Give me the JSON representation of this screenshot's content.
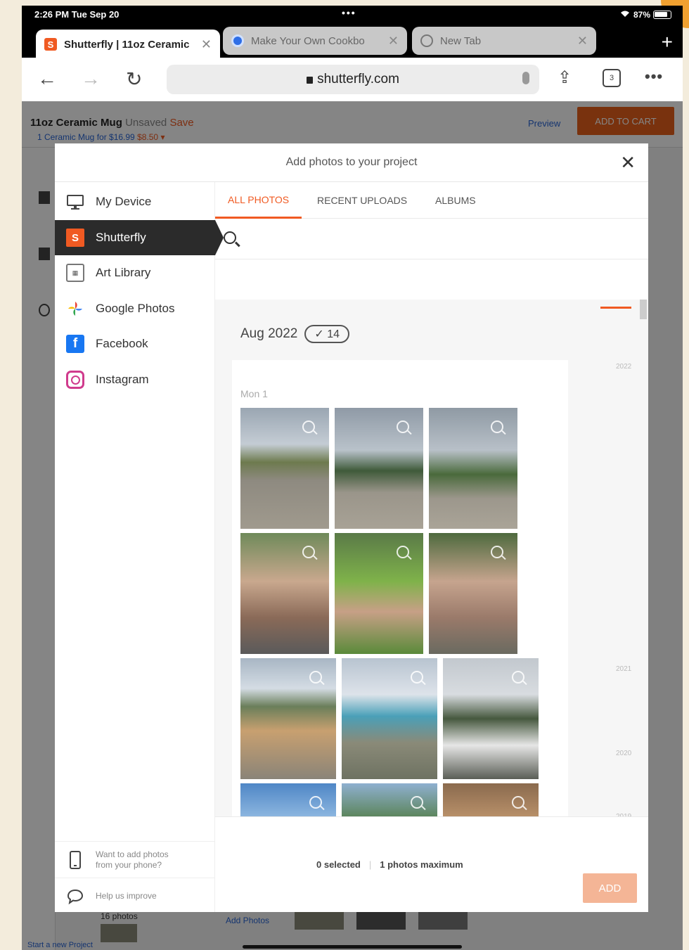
{
  "status_bar": {
    "time": "2:26 PM  Tue Sep 20",
    "dots": "•••",
    "battery": "87%"
  },
  "browser": {
    "tabs": [
      {
        "title": "Shutterfly | 11oz Ceramic"
      },
      {
        "title": "Make Your Own Cookbo"
      },
      {
        "title": "New Tab"
      }
    ],
    "url": "shutterfly.com",
    "tab_count": "3",
    "new_tab": "+"
  },
  "background_page": {
    "product": "11oz Ceramic Mug",
    "unsaved": "Unsaved",
    "save": "Save",
    "subtitle": "1 Ceramic Mug for $16.99",
    "subtitle_price": "$8.50 ▾",
    "preview": "Preview",
    "add_to_cart": "ADD TO CART",
    "photos_label": "16 photos",
    "add_photos": "Add Photos",
    "footer_link": "Start a new Project"
  },
  "modal": {
    "title": "Add photos to your project",
    "close": "✕",
    "sources": [
      {
        "label": "My Device",
        "icon": "monitor-icon"
      },
      {
        "label": "Shutterfly",
        "icon": "shutterfly-icon"
      },
      {
        "label": "Art Library",
        "icon": "art-library-icon"
      },
      {
        "label": "Google Photos",
        "icon": "google-photos-icon"
      },
      {
        "label": "Facebook",
        "icon": "facebook-icon"
      },
      {
        "label": "Instagram",
        "icon": "instagram-icon"
      }
    ],
    "phone_prompt": [
      "Want to add photos",
      "from your phone?"
    ],
    "feedback": "Help us improve",
    "tabs": [
      "ALL PHOTOS",
      "RECENT UPLOADS",
      "ALBUMS"
    ],
    "date_group": "Aug 2022",
    "photo_count": "✓ 14",
    "day": "Mon 1",
    "years": [
      "2022",
      "2021",
      "2020",
      "2019"
    ],
    "selected": "0 selected",
    "separator": "|",
    "max": "1 photos maximum",
    "add": "ADD",
    "accent": "#f05a22"
  }
}
